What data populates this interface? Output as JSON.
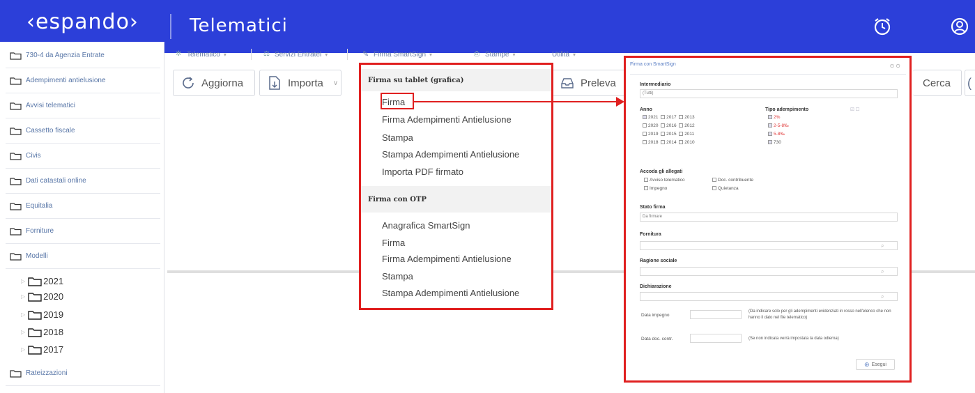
{
  "header": {
    "logo": "‹espando›",
    "title": "Telematici",
    "bg": "#2c3fd9"
  },
  "sidebar": {
    "items": [
      "730-4 da Agenzia Entrate",
      "Adempimenti antielusione",
      "Avvisi telematici",
      "Cassetto fiscale",
      "Civis",
      "Dati catastali online",
      "Equitalia",
      "Forniture",
      "Modelli"
    ],
    "years": [
      "2021",
      "2020",
      "2019",
      "2018",
      "2017"
    ],
    "last_item": "Rateizzazioni"
  },
  "menubar": {
    "telematico": "Telematico",
    "servizi": "Servizi Entratel",
    "firma": "Firma SmartSign",
    "stampe": "Stampe",
    "utilita": "Utilità"
  },
  "toolbar": {
    "aggiorna": "Aggiorna",
    "importa": "Importa",
    "preleva": "Preleva",
    "cerca": "Cerca"
  },
  "dropdown": {
    "section1": "Firma su tablet (grafica)",
    "section1_items": [
      "Firma",
      "Firma Adempimenti Antielusione",
      "Stampa",
      "Stampa Adempimenti Antielusione",
      "Importa PDF firmato"
    ],
    "section2": "Firma con OTP",
    "section2_items": [
      "Anagrafica SmartSign",
      "Firma",
      "Firma Adempimenti Antielusione",
      "Stampa",
      "Stampa Adempimenti Antielusione"
    ]
  },
  "dialog": {
    "title": "Firma con SmartSign",
    "intermediario_label": "Intermediario",
    "intermediario_value": "(Tutti)",
    "anno_label": "Anno",
    "anni": [
      "2021",
      "2017",
      "2013",
      "2020",
      "2016",
      "2012",
      "2019",
      "2015",
      "2011",
      "2018",
      "2014",
      "2010"
    ],
    "tipo_label": "Tipo adempimento",
    "tipi": [
      "2%",
      "2-5-8‰",
      "5-8‰",
      "730"
    ],
    "allegati_label": "Accoda gli allegati",
    "allegati": [
      "Avviso telematico",
      "Doc. contribuente",
      "Impegno",
      "Quietanza"
    ],
    "stato_label": "Stato firma",
    "stato_value": "Da firmare",
    "fornitura_label": "Fornitura",
    "ragione_label": "Ragione sociale",
    "dichiarazione_label": "Dichiarazione",
    "data_impegno_label": "Data impegno",
    "data_impegno_note": "(Da indicare solo per gli adempimenti evidenziati in rosso nell'elenco che non hanno il dato nel file telematico)",
    "data_doc_label": "Data doc. contr.",
    "data_doc_note": "(Se non indicata verrà impostata la data odierna)",
    "esegui": "Esegui"
  }
}
